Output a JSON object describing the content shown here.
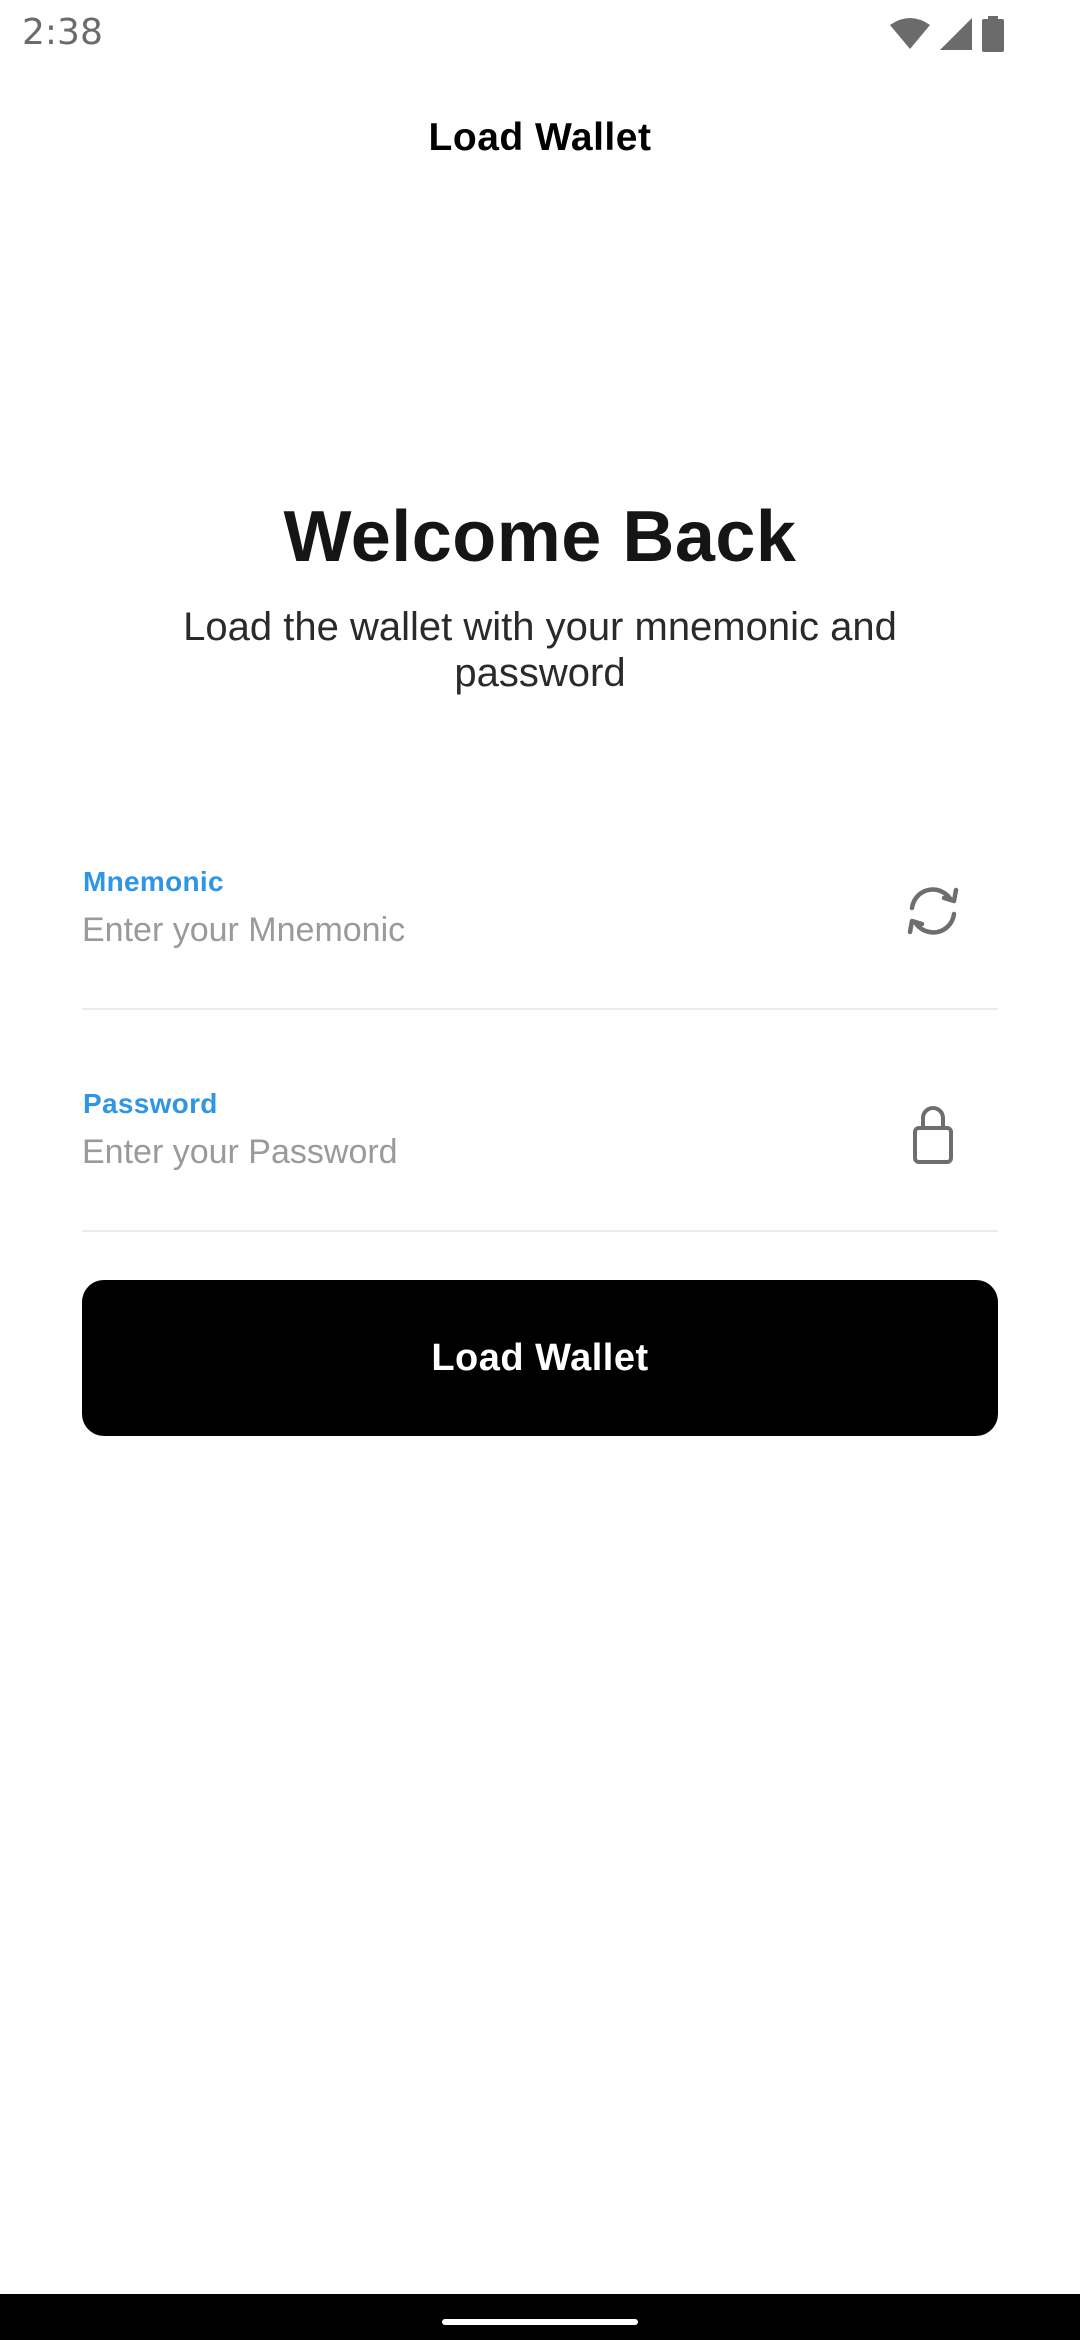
{
  "status_bar": {
    "time": "2:38",
    "icons": [
      "wifi-icon",
      "signal-icon",
      "battery-icon"
    ]
  },
  "header": {
    "title": "Load Wallet"
  },
  "welcome": {
    "title": "Welcome Back",
    "subtitle": "Load the wallet with your mnemonic and password"
  },
  "form": {
    "mnemonic": {
      "label": "Mnemonic",
      "placeholder": "Enter your Mnemonic",
      "value": "",
      "icon": "refresh-icon"
    },
    "password": {
      "label": "Password",
      "placeholder": "Enter your Password",
      "value": "",
      "icon": "lock-icon"
    },
    "submit_label": "Load Wallet"
  },
  "colors": {
    "accent": "#2f96e6",
    "button": "#000000",
    "button_text": "#ffffff",
    "background": "#ffffff"
  }
}
